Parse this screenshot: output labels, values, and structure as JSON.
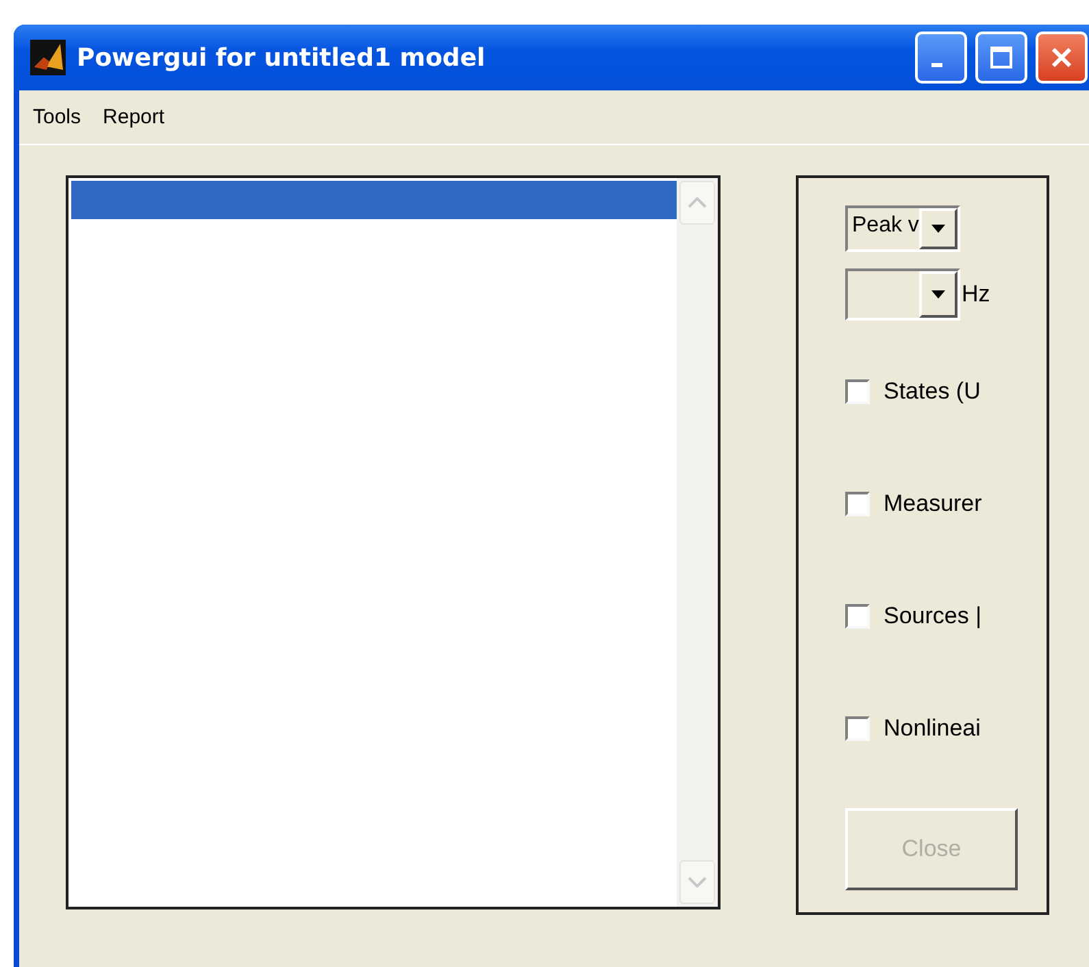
{
  "window": {
    "title": "Powergui for untitled1 model"
  },
  "menu": [
    "Tools",
    "Report"
  ],
  "list": {
    "rows": [
      {
        "selected": true
      }
    ]
  },
  "options": {
    "display": {
      "value": "Peak v"
    },
    "frequency": {
      "unit": "Hz"
    },
    "checkboxes": [
      {
        "label": "States (U",
        "checked": false
      },
      {
        "label": "Measurer",
        "checked": false
      },
      {
        "label": "Sources |",
        "checked": false
      },
      {
        "label": "Nonlineai",
        "checked": false
      }
    ],
    "close_button": {
      "label": "Close",
      "disabled": true
    }
  }
}
